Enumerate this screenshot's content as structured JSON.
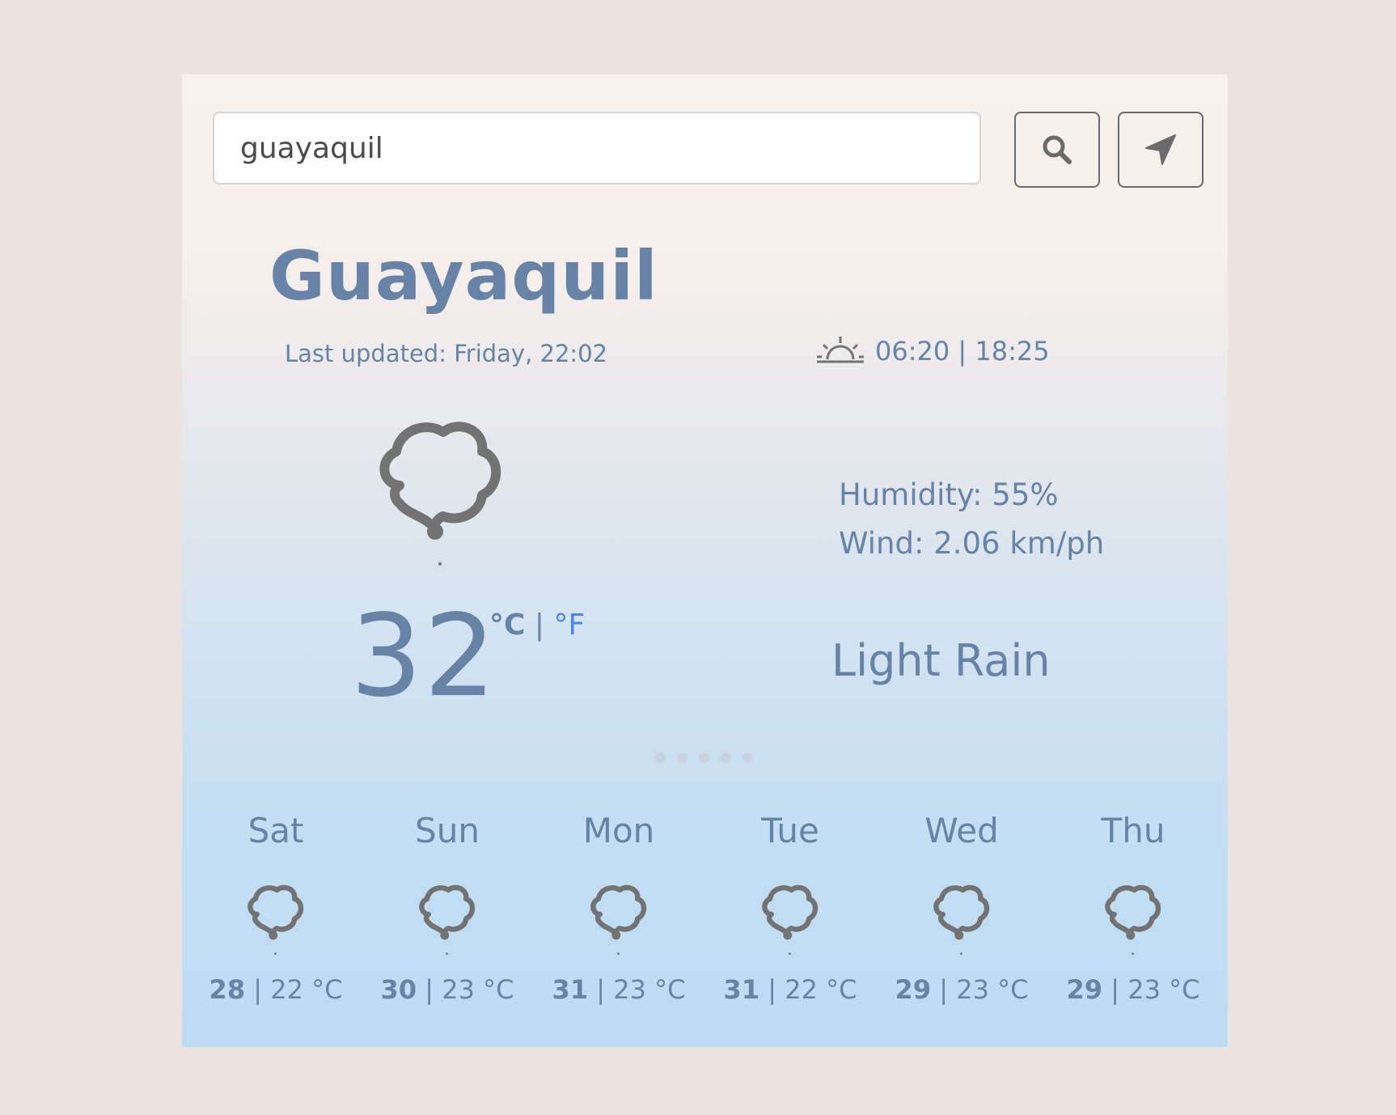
{
  "search": {
    "value": "guayaquil",
    "search_icon": "search-icon",
    "locate_icon": "location-arrow-icon"
  },
  "current": {
    "city": "Guayaquil",
    "last_updated": "Last updated: Friday, 22:02",
    "sun_times": "06:20 | 18:25",
    "sun_icon": "sunrise-icon",
    "icon": "rain-cloud-icon",
    "humidity": "Humidity: 55%",
    "wind": "Wind: 2.06 km/ph",
    "temperature": "32",
    "unit_c": "°C",
    "unit_sep": " | ",
    "unit_f": "°F",
    "description": "Light Rain"
  },
  "forecast": [
    {
      "day": "Sat",
      "hi": "28",
      "lo": " | 22 °C",
      "icon": "rain-cloud-icon"
    },
    {
      "day": "Sun",
      "hi": "30",
      "lo": " | 23 °C",
      "icon": "rain-cloud-icon"
    },
    {
      "day": "Mon",
      "hi": "31",
      "lo": " | 23 °C",
      "icon": "rain-cloud-icon"
    },
    {
      "day": "Tue",
      "hi": "31",
      "lo": " | 22 °C",
      "icon": "rain-cloud-icon"
    },
    {
      "day": "Wed",
      "hi": "29",
      "lo": " | 23 °C",
      "icon": "rain-cloud-icon"
    },
    {
      "day": "Thu",
      "hi": "29",
      "lo": " | 23 °C",
      "icon": "rain-cloud-icon"
    }
  ],
  "colors": {
    "page_bg": "#ece3df",
    "text": "#6783a6",
    "link": "#4e86e8",
    "icon": "#737373"
  }
}
